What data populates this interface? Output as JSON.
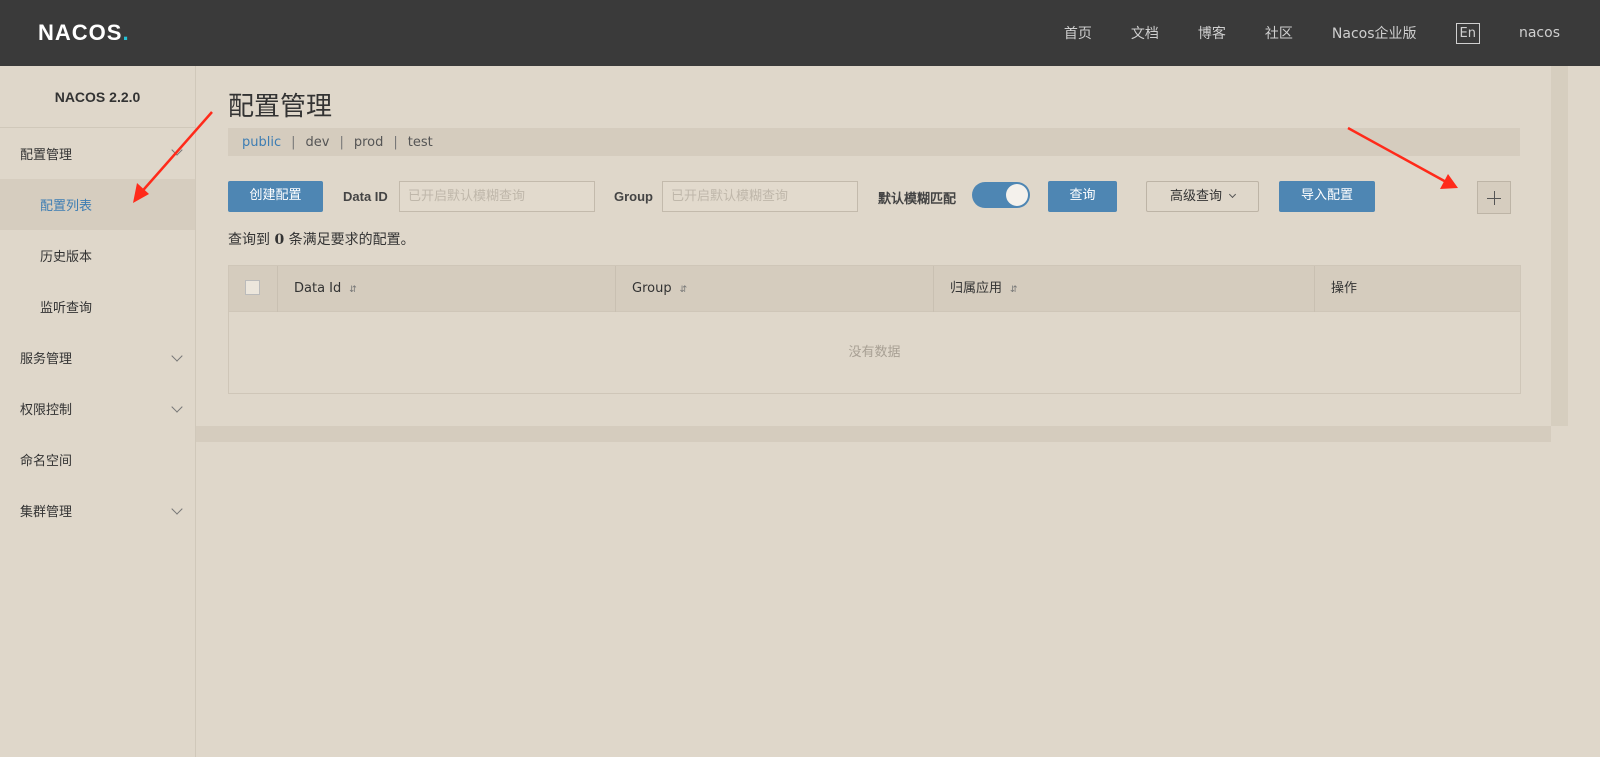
{
  "header": {
    "logo_text": "NAC",
    "logo_text_2": "OS",
    "logo_dot": ".",
    "nav": [
      "首页",
      "文档",
      "博客",
      "社区",
      "Nacos企业版"
    ],
    "lang": "En",
    "user": "nacos"
  },
  "sidebar": {
    "title": "NACOS 2.2.0",
    "items": [
      {
        "label": "配置管理",
        "type": "group"
      },
      {
        "label": "配置列表",
        "type": "sub",
        "active": true
      },
      {
        "label": "历史版本",
        "type": "sub"
      },
      {
        "label": "监听查询",
        "type": "sub"
      },
      {
        "label": "服务管理",
        "type": "group"
      },
      {
        "label": "权限控制",
        "type": "group"
      },
      {
        "label": "命名空间",
        "type": "group"
      },
      {
        "label": "集群管理",
        "type": "group"
      }
    ]
  },
  "main": {
    "title": "配置管理",
    "namespaces": [
      "public",
      "dev",
      "prod",
      "test"
    ],
    "namespace_sep": "|",
    "create_button": "创建配置",
    "dataid_label": "Data ID",
    "dataid_placeholder": "已开启默认模糊查询",
    "group_label": "Group",
    "group_placeholder": "已开启默认模糊查询",
    "fuzzy_label": "默认模糊匹配",
    "fuzzy_on": true,
    "query_button": "查询",
    "advanced_button": "高级查询",
    "import_button": "导入配置",
    "result_prefix": "查询到",
    "result_count": "0",
    "result_suffix": "条满足要求的配置。",
    "table": {
      "columns": [
        "Data Id",
        "Group",
        "归属应用",
        "操作"
      ],
      "empty_text": "没有数据"
    }
  },
  "colors": {
    "accent": "#4e86b3",
    "topbar": "#3a3a3a",
    "background": "#dfd7ca",
    "annotation_arrow": "#ff2a1a"
  }
}
